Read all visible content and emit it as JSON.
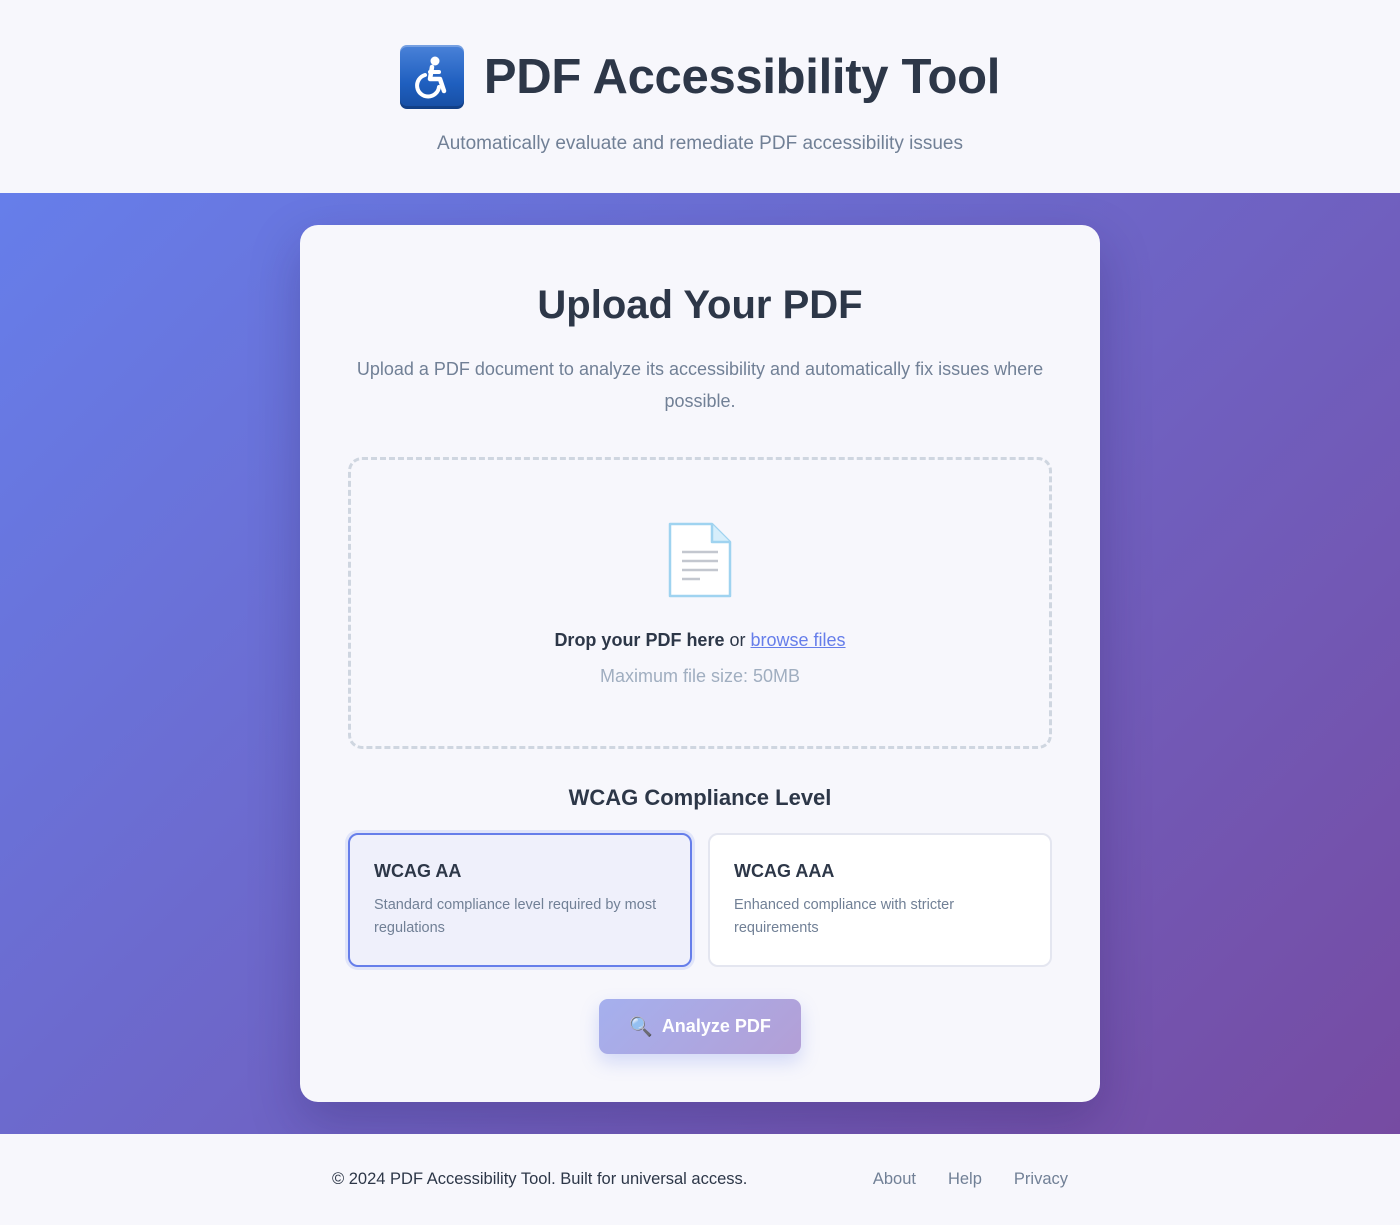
{
  "header": {
    "logo_icon": "wheelchair-accessibility-icon",
    "title": "PDF Accessibility Tool",
    "subtitle": "Automatically evaluate and remediate PDF accessibility issues"
  },
  "upload": {
    "title": "Upload Your PDF",
    "description": "Upload a PDF document to analyze its accessibility and automatically fix issues where possible.",
    "dropzone": {
      "icon": "document-icon",
      "drop_text": "Drop your PDF here",
      "or_text": "or",
      "browse_label": "browse files",
      "size_note": "Maximum file size: 50MB"
    }
  },
  "compliance": {
    "heading": "WCAG Compliance Level",
    "options": [
      {
        "name": "WCAG AA",
        "description": "Standard compliance level required by most regulations",
        "selected": true
      },
      {
        "name": "WCAG AAA",
        "description": "Enhanced compliance with stricter requirements",
        "selected": false
      }
    ]
  },
  "actions": {
    "analyze_icon": "magnifier-icon",
    "analyze_label": "Analyze PDF"
  },
  "footer": {
    "copyright": "© 2024 PDF Accessibility Tool. Built for universal access.",
    "links": [
      "About",
      "Help",
      "Privacy"
    ]
  },
  "colors": {
    "accent": "#667eea",
    "gradient_start": "#667eea",
    "gradient_end": "#764ba2",
    "text_primary": "#2d3748",
    "text_muted": "#718096"
  }
}
